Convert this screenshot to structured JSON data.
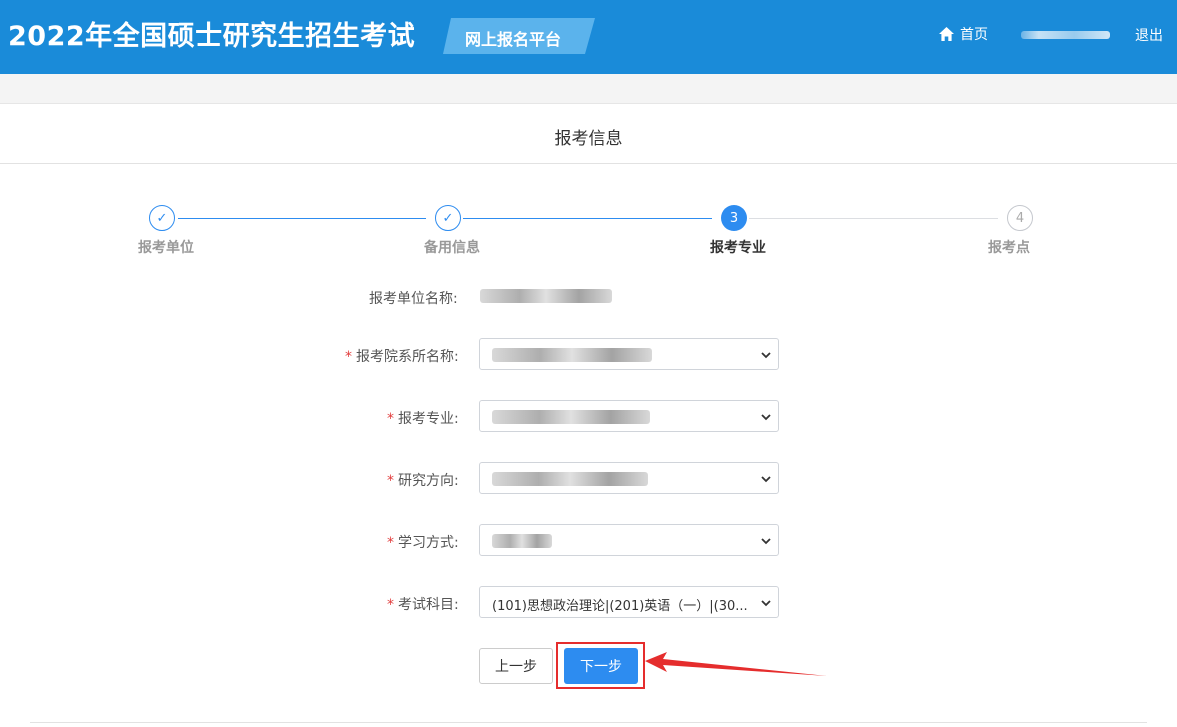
{
  "header": {
    "title": "2022年全国硕士研究生招生考试",
    "platform": "网上报名平台",
    "home_label": "首页",
    "logout_label": "退出"
  },
  "section": {
    "title": "报考信息"
  },
  "steps": [
    {
      "label": "报考单位",
      "status": "finished",
      "marker": "✓"
    },
    {
      "label": "备用信息",
      "status": "finished",
      "marker": "✓"
    },
    {
      "label": "报考专业",
      "status": "active",
      "marker": "3"
    },
    {
      "label": "报考点",
      "status": "waiting",
      "marker": "4"
    }
  ],
  "form": {
    "unit_name_label": "报考单位名称:",
    "department_label": "报考院系所名称:",
    "major_label": "报考专业:",
    "direction_label": "研究方向:",
    "study_mode_label": "学习方式:",
    "subjects_label": "考试科目:",
    "subjects_value": "(101)思想政治理论|(201)英语（一）|(30..."
  },
  "buttons": {
    "prev": "上一步",
    "next": "下一步"
  },
  "colors": {
    "header_bg": "#1a8bd9",
    "primary": "#2d8cf0",
    "highlight": "#e52d2d"
  }
}
